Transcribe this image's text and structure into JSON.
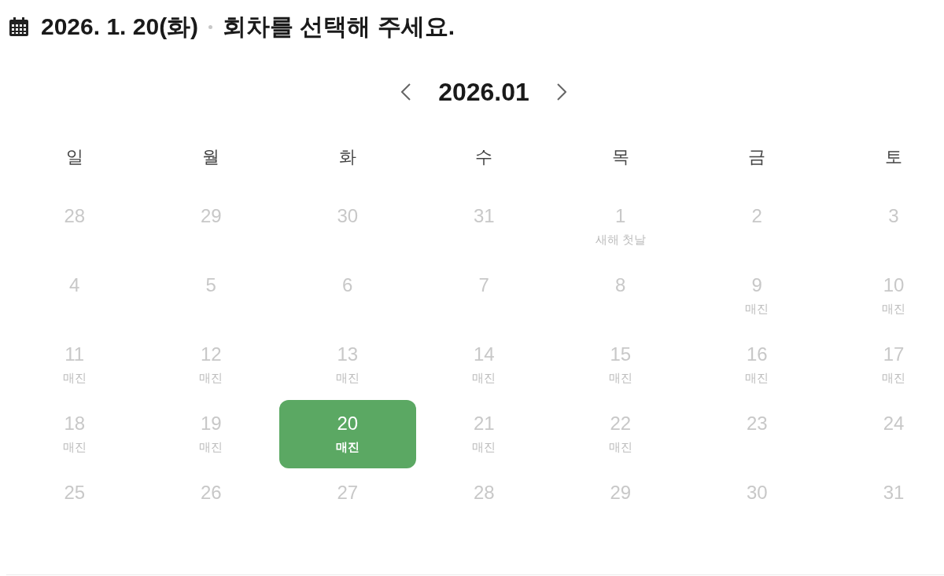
{
  "header": {
    "date": "2026. 1. 20(화)",
    "prompt": "회차를 선택해 주세요."
  },
  "calendar": {
    "month": "2026.01",
    "weekdays": [
      "일",
      "월",
      "화",
      "수",
      "목",
      "금",
      "토"
    ],
    "weeks": [
      [
        {
          "day": "28",
          "selected": false
        },
        {
          "day": "29",
          "selected": false
        },
        {
          "day": "30",
          "selected": false
        },
        {
          "day": "31",
          "selected": false
        },
        {
          "day": "1",
          "note": "새해 첫날",
          "selected": false
        },
        {
          "day": "2",
          "selected": false
        },
        {
          "day": "3",
          "selected": false
        }
      ],
      [
        {
          "day": "4",
          "selected": false
        },
        {
          "day": "5",
          "selected": false
        },
        {
          "day": "6",
          "selected": false
        },
        {
          "day": "7",
          "selected": false
        },
        {
          "day": "8",
          "selected": false
        },
        {
          "day": "9",
          "note": "매진",
          "selected": false
        },
        {
          "day": "10",
          "note": "매진",
          "selected": false
        }
      ],
      [
        {
          "day": "11",
          "note": "매진",
          "selected": false
        },
        {
          "day": "12",
          "note": "매진",
          "selected": false
        },
        {
          "day": "13",
          "note": "매진",
          "selected": false
        },
        {
          "day": "14",
          "note": "매진",
          "selected": false
        },
        {
          "day": "15",
          "note": "매진",
          "selected": false
        },
        {
          "day": "16",
          "note": "매진",
          "selected": false
        },
        {
          "day": "17",
          "note": "매진",
          "selected": false
        }
      ],
      [
        {
          "day": "18",
          "note": "매진",
          "selected": false
        },
        {
          "day": "19",
          "note": "매진",
          "selected": false
        },
        {
          "day": "20",
          "note": "매진",
          "selected": true
        },
        {
          "day": "21",
          "note": "매진",
          "selected": false
        },
        {
          "day": "22",
          "note": "매진",
          "selected": false
        },
        {
          "day": "23",
          "selected": false
        },
        {
          "day": "24",
          "selected": false
        }
      ],
      [
        {
          "day": "25",
          "selected": false
        },
        {
          "day": "26",
          "selected": false
        },
        {
          "day": "27",
          "selected": false
        },
        {
          "day": "28",
          "selected": false
        },
        {
          "day": "29",
          "selected": false
        },
        {
          "day": "30",
          "selected": false
        },
        {
          "day": "31",
          "selected": false
        }
      ]
    ]
  }
}
